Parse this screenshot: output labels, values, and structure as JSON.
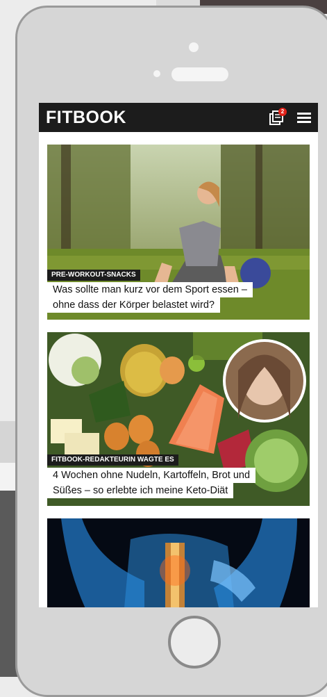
{
  "app": {
    "logo": "FITBOOK",
    "notification_count": "2",
    "accent_color": "#e2231a",
    "header_bg": "#1c1c1c"
  },
  "articles": [
    {
      "kicker": "PRE-WORKOUT-SNACKS",
      "headline_lines": [
        "Was sollte man kurz vor dem Sport essen –",
        "ohne dass der Körper belastet wird?"
      ]
    },
    {
      "kicker": "FITBOOK-REDAKTEURIN WAGTE ES",
      "headline_lines": [
        "4 Wochen ohne Nudeln, Kartoffeln, Brot und",
        "Süßes – so erlebte ich meine Keto-Diät"
      ]
    },
    {
      "kicker": "",
      "headline_lines": []
    }
  ],
  "icons": [
    "notification-icon",
    "hamburger-menu-icon"
  ]
}
